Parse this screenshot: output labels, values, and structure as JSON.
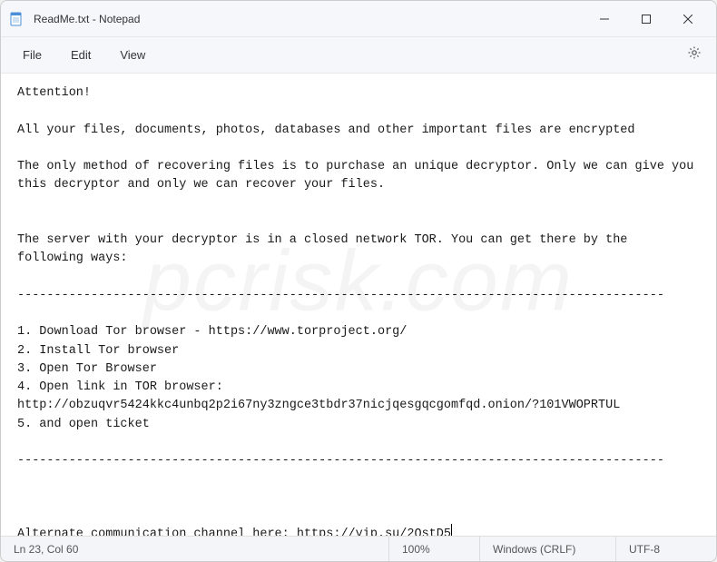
{
  "titlebar": {
    "title": "ReadMe.txt - Notepad"
  },
  "menubar": {
    "file": "File",
    "edit": "Edit",
    "view": "View"
  },
  "content": {
    "text": "Attention!\n\nAll your files, documents, photos, databases and other important files are encrypted\n\nThe only method of recovering files is to purchase an unique decryptor. Only we can give you this decryptor and only we can recover your files.\n\n\nThe server with your decryptor is in a closed network TOR. You can get there by the following ways:\n\n----------------------------------------------------------------------------------------\n\n1. Download Tor browser - https://www.torproject.org/\n2. Install Tor browser\n3. Open Tor Browser\n4. Open link in TOR browser: http://obzuqvr5424kkc4unbq2p2i67ny3zngce3tbdr37nicjqesgqcgomfqd.onion/?101VWOPRTUL\n5. and open ticket\n\n----------------------------------------------------------------------------------------\n\n\n\nAlternate communication channel here: https://yip.su/2QstD5"
  },
  "statusbar": {
    "position": "Ln 23, Col 60",
    "zoom": "100%",
    "eol": "Windows (CRLF)",
    "encoding": "UTF-8"
  },
  "watermark": "pcrisk.com"
}
